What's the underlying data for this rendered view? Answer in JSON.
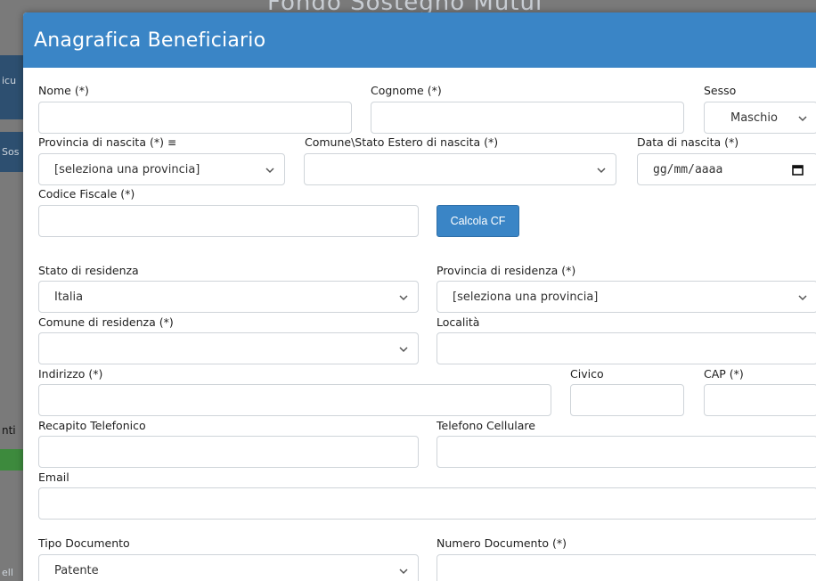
{
  "background": {
    "title": "Fondo Sostegno Mutui",
    "side_labels": [
      "icu",
      "Sos",
      "nti",
      "ell"
    ]
  },
  "modal": {
    "title": "Anagrafica Beneficiario"
  },
  "form": {
    "nome": {
      "label": "Nome (*)",
      "value": ""
    },
    "cognome": {
      "label": "Cognome (*)",
      "value": ""
    },
    "sesso": {
      "label": "Sesso",
      "value": "Maschio"
    },
    "provincia_nascita": {
      "label": "Provincia di nascita (*)",
      "icon": "list-icon",
      "value": "[seleziona una provincia]"
    },
    "comune_nascita": {
      "label": "Comune\\Stato Estero di nascita (*)",
      "value": ""
    },
    "data_nascita": {
      "label": "Data di nascita (*)",
      "placeholder": "gg/mm/aaaa"
    },
    "codice_fiscale": {
      "label": "Codice Fiscale (*)",
      "value": ""
    },
    "calcola_cf": {
      "label": "Calcola CF"
    },
    "stato_residenza": {
      "label": "Stato di residenza",
      "value": "Italia"
    },
    "provincia_residenza": {
      "label": "Provincia di residenza (*)",
      "value": "[seleziona una provincia]"
    },
    "comune_residenza": {
      "label": "Comune di residenza (*)",
      "value": ""
    },
    "localita": {
      "label": "Località",
      "value": ""
    },
    "indirizzo": {
      "label": "Indirizzo (*)",
      "value": ""
    },
    "civico": {
      "label": "Civico",
      "value": ""
    },
    "cap": {
      "label": "CAP (*)",
      "value": ""
    },
    "recapito_telefonico": {
      "label": "Recapito Telefonico",
      "value": ""
    },
    "telefono_cellulare": {
      "label": "Telefono Cellulare",
      "value": ""
    },
    "email": {
      "label": "Email",
      "value": ""
    },
    "tipo_documento": {
      "label": "Tipo Documento",
      "value": "Patente"
    },
    "numero_documento": {
      "label": "Numero Documento (*)",
      "value": ""
    }
  },
  "colors": {
    "header": "#3a85c6",
    "button": "#3a85c6",
    "border": "#cfd4d9"
  }
}
